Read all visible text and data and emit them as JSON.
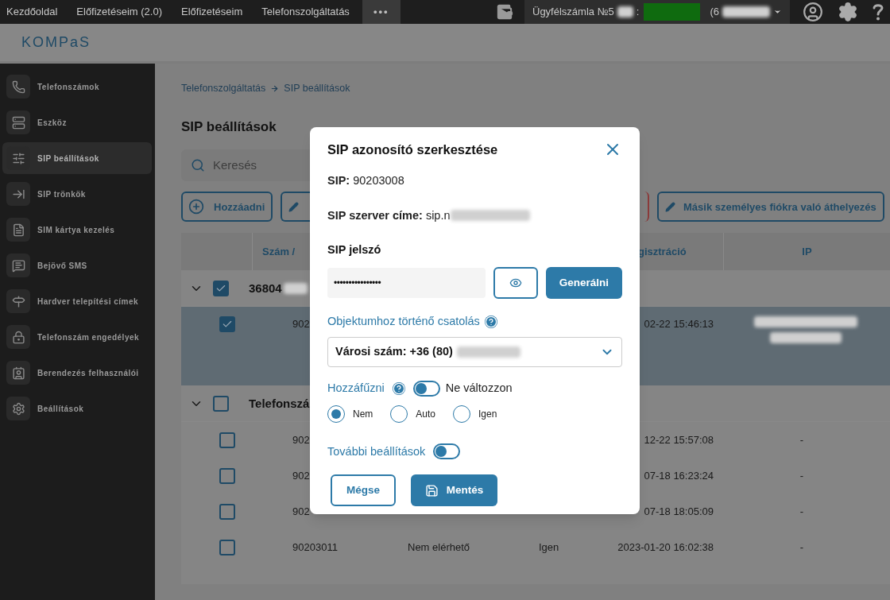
{
  "top_nav": {
    "items": [
      {
        "label": "Kezdőoldal",
        "selected": false
      },
      {
        "label": "Előfizetéseim (2.0)",
        "selected": false
      },
      {
        "label": "Előfizetéseim",
        "selected": false
      },
      {
        "label": "Telefonszolgáltatás",
        "selected": false
      },
      {
        "label": "•••",
        "selected": true
      }
    ],
    "account": {
      "label": "Ügyfélszámla №5",
      "separator": ":",
      "balance_prefix": "(6"
    }
  },
  "logo": {
    "text": "KOMPaS"
  },
  "sidebar": {
    "items": [
      {
        "label": "Telefonszámok",
        "selected": false
      },
      {
        "label": "Eszköz",
        "selected": false
      },
      {
        "label": "SIP beállítások",
        "selected": true
      },
      {
        "label": "SIP trönkök",
        "selected": false
      },
      {
        "label": "SIM kártya kezelés",
        "selected": false
      },
      {
        "label": "Bejövő SMS",
        "selected": false
      },
      {
        "label": "Hardver telepítési címek",
        "selected": false
      },
      {
        "label": "Telefonszám engedélyek",
        "selected": false
      },
      {
        "label": "Berendezés felhasználói",
        "selected": false
      },
      {
        "label": "Beállítások",
        "selected": false
      }
    ]
  },
  "breadcrumb": [
    "Telefonszolgáltatás",
    "SIP beállítások"
  ],
  "page_title": "SIP beállítások",
  "search": {
    "placeholder": "Keresés"
  },
  "toolbar": {
    "add": "Hozzáadni",
    "move": "Másik személyes fiókra való áthelyezés"
  },
  "table": {
    "columns": [
      "Szám /",
      "gisztráció",
      "IP"
    ],
    "groups": [
      {
        "label": "36804",
        "checked": true,
        "expanded": true,
        "rows": [
          {
            "checked": true,
            "selected": true,
            "number": "902",
            "registration": "02-22 15:46:13"
          }
        ]
      },
      {
        "label": "Telefonszá",
        "checked": false,
        "expanded": true,
        "rows": [
          {
            "checked": false,
            "selected": false,
            "number": "902",
            "registration": "12-22 15:57:08",
            "ip": "-"
          },
          {
            "checked": false,
            "selected": false,
            "number": "902",
            "registration": "07-18 16:23:24",
            "ip": "-"
          },
          {
            "checked": false,
            "selected": false,
            "number": "902",
            "registration": "07-18 18:05:09",
            "ip": "-"
          },
          {
            "checked": false,
            "selected": false,
            "number": "90203011",
            "status": "Nem elérhető",
            "column_3": "Igen",
            "registration": "2023-01-20 16:02:38",
            "ip": "-"
          }
        ]
      }
    ]
  },
  "modal": {
    "title": "SIP azonosító szerkesztése",
    "sip_label": "SIP:",
    "sip_value": "90203008",
    "server_label": "SIP szerver címe:",
    "server_value": "sip.n",
    "password_label": "SIP jelszó",
    "password_value": "••••••••••••••••",
    "generate": "Generálni",
    "attach_label": "Objektumhoz történő csatolás",
    "attach_value": "Városi szám: +36 (80)",
    "append_label": "Hozzáfűzni",
    "append_toggle": {
      "on": false,
      "label": "Ne változzon"
    },
    "radios": [
      {
        "label": "Nem",
        "selected": true
      },
      {
        "label": "Auto",
        "selected": false
      },
      {
        "label": "Igen",
        "selected": false
      }
    ],
    "more_settings": {
      "label": "További beállítások",
      "on": false
    },
    "cancel": "Mégse",
    "save": "Mentés"
  }
}
